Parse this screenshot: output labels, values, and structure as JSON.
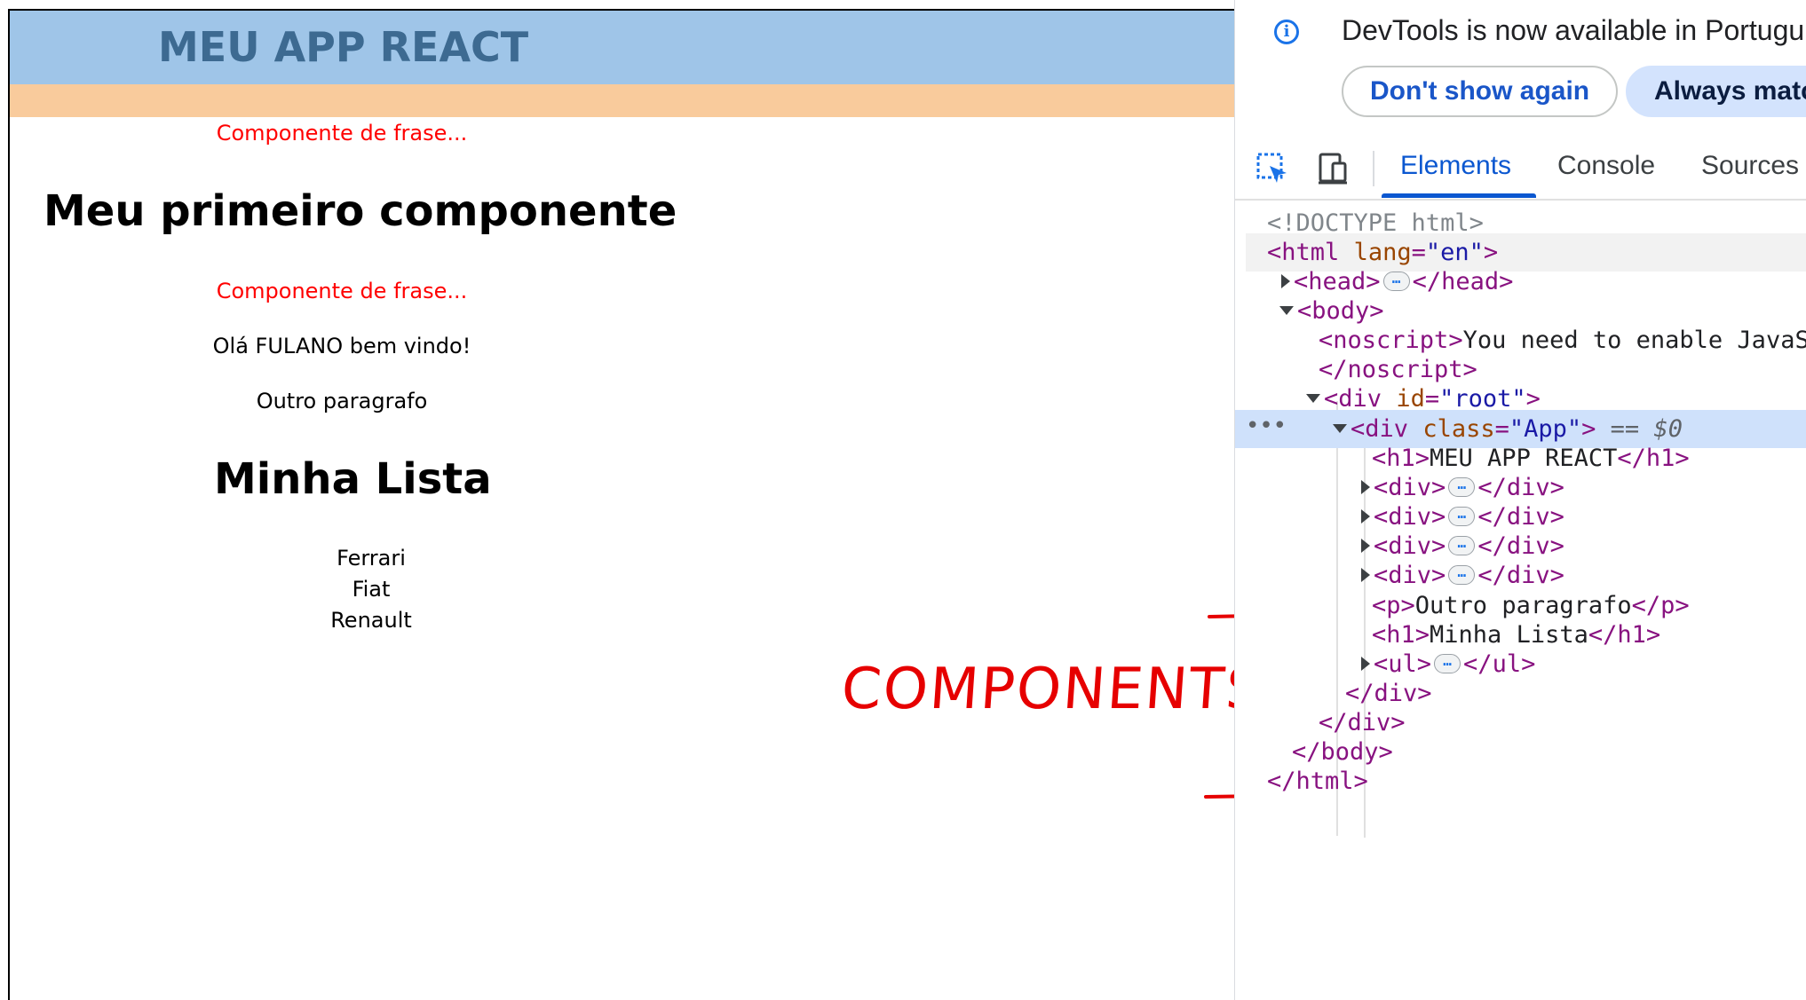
{
  "app": {
    "header_title": "MEU APP REACT",
    "phrase_1": "Componente de frase...",
    "heading_1": "Meu primeiro componente",
    "phrase_2": "Componente de frase...",
    "greeting": "Olá FULANO bem vindo!",
    "paragraph": "Outro paragrafo",
    "list_heading": "Minha Lista",
    "list_items": [
      "Ferrari",
      "Fiat",
      "Renault"
    ],
    "colors": {
      "header_bg": "#9fc5e8",
      "header_band": "#f9cb9c",
      "phrase": "#ff0000",
      "title": "#3d6a91"
    }
  },
  "annotation": {
    "label": "COMPONENTS",
    "color": "#e60000"
  },
  "devtools": {
    "info_message": "DevTools is now available in Portugu",
    "info_icon": "info-icon",
    "dont_show_label": "Don't show again",
    "always_match_label": "Always matcl",
    "inspect_icon": "inspect-element-icon",
    "device_icon": "device-toolbar-icon",
    "tabs": [
      "Elements",
      "Console",
      "Sources"
    ],
    "active_tab": "Elements",
    "tree": {
      "doctype": "<!DOCTYPE html>",
      "html_tag": "html",
      "html_attr": "lang",
      "html_val": "\"en\"",
      "head": "head",
      "body": "body",
      "noscript_open": "noscript",
      "noscript_text": "You need to enable JavaS",
      "noscript_close": "</noscript>",
      "root_tag": "div",
      "root_attr": "id",
      "root_val": "\"root\"",
      "app_tag": "div",
      "app_attr": "class",
      "app_val": "\"App\"",
      "app_suffix": "== $0",
      "h1_text": "MEU APP REACT",
      "div_tag": "div",
      "p_text": "Outro paragrafo",
      "h1_list_text": "Minha Lista",
      "ul_tag": "ul",
      "close_div": "</div>",
      "close_body": "</body>",
      "close_html": "</html>",
      "selected_marker": "•••"
    }
  }
}
